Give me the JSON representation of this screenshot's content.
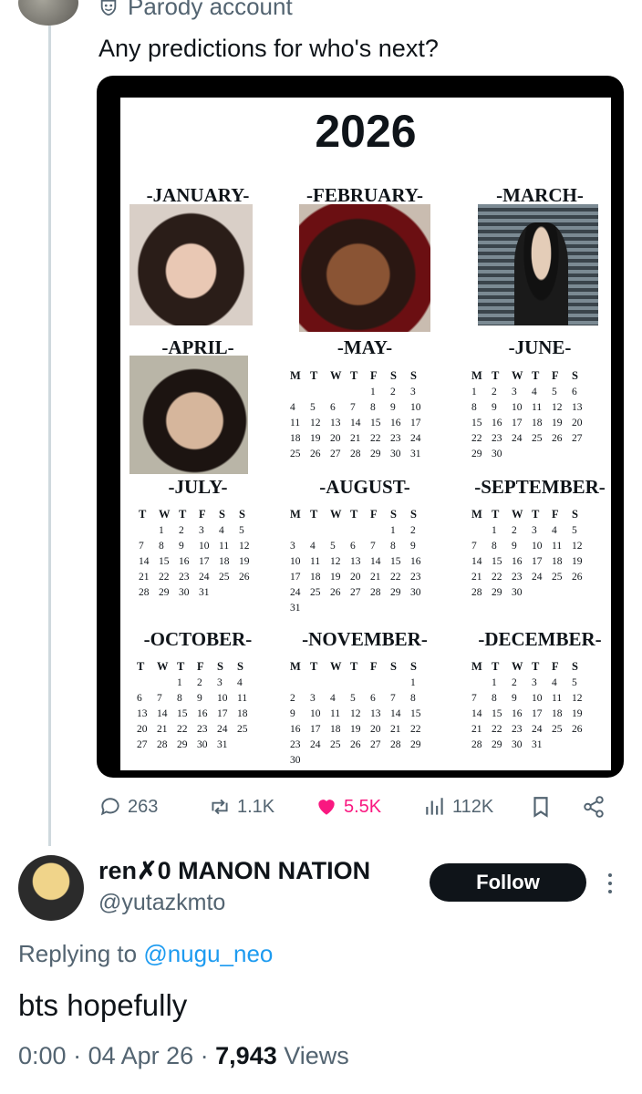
{
  "parent_tweet": {
    "label": "Parody account",
    "text": "Any predictions for who's next?"
  },
  "calendar": {
    "year": "2026",
    "months": [
      {
        "name": "-JANUARY-",
        "has_photo": true
      },
      {
        "name": "-FEBRUARY-",
        "has_photo": true
      },
      {
        "name": "-MARCH-",
        "has_photo": true
      },
      {
        "name": "-APRIL-",
        "has_photo": true
      },
      {
        "name": "-MAY-",
        "rows": [
          [
            "M",
            "T",
            "W",
            "T",
            "F",
            "S",
            "S"
          ],
          [
            "",
            "",
            "",
            "",
            "1",
            "2",
            "3"
          ],
          [
            "4",
            "5",
            "6",
            "7",
            "8",
            "9",
            "10"
          ],
          [
            "11",
            "12",
            "13",
            "14",
            "15",
            "16",
            "17"
          ],
          [
            "18",
            "19",
            "20",
            "21",
            "22",
            "23",
            "24"
          ],
          [
            "25",
            "26",
            "27",
            "28",
            "29",
            "30",
            "31"
          ]
        ]
      },
      {
        "name": "-JUNE-",
        "rows": [
          [
            "M",
            "T",
            "W",
            "T",
            "F",
            "S"
          ],
          [
            "1",
            "2",
            "3",
            "4",
            "5",
            "6"
          ],
          [
            "8",
            "9",
            "10",
            "11",
            "12",
            "13"
          ],
          [
            "15",
            "16",
            "17",
            "18",
            "19",
            "20"
          ],
          [
            "22",
            "23",
            "24",
            "25",
            "26",
            "27"
          ],
          [
            "29",
            "30",
            "",
            "",
            "",
            ""
          ]
        ]
      },
      {
        "name": "-JULY-",
        "rows": [
          [
            "T",
            "W",
            "T",
            "F",
            "S",
            "S"
          ],
          [
            "",
            "1",
            "2",
            "3",
            "4",
            "5"
          ],
          [
            "7",
            "8",
            "9",
            "10",
            "11",
            "12"
          ],
          [
            "14",
            "15",
            "16",
            "17",
            "18",
            "19"
          ],
          [
            "21",
            "22",
            "23",
            "24",
            "25",
            "26"
          ],
          [
            "28",
            "29",
            "30",
            "31",
            "",
            ""
          ]
        ]
      },
      {
        "name": "-AUGUST-",
        "rows": [
          [
            "M",
            "T",
            "W",
            "T",
            "F",
            "S",
            "S"
          ],
          [
            "",
            "",
            "",
            "",
            "",
            "1",
            "2"
          ],
          [
            "3",
            "4",
            "5",
            "6",
            "7",
            "8",
            "9"
          ],
          [
            "10",
            "11",
            "12",
            "13",
            "14",
            "15",
            "16"
          ],
          [
            "17",
            "18",
            "19",
            "20",
            "21",
            "22",
            "23"
          ],
          [
            "24",
            "25",
            "26",
            "27",
            "28",
            "29",
            "30"
          ],
          [
            "31",
            "",
            "",
            "",
            "",
            "",
            ""
          ]
        ]
      },
      {
        "name": "-SEPTEMBER-",
        "rows": [
          [
            "M",
            "T",
            "W",
            "T",
            "F",
            "S"
          ],
          [
            "",
            "1",
            "2",
            "3",
            "4",
            "5"
          ],
          [
            "7",
            "8",
            "9",
            "10",
            "11",
            "12"
          ],
          [
            "14",
            "15",
            "16",
            "17",
            "18",
            "19"
          ],
          [
            "21",
            "22",
            "23",
            "24",
            "25",
            "26"
          ],
          [
            "28",
            "29",
            "30",
            "",
            "",
            ""
          ]
        ]
      },
      {
        "name": "-OCTOBER-",
        "rows": [
          [
            "T",
            "W",
            "T",
            "F",
            "S",
            "S"
          ],
          [
            "",
            "",
            "1",
            "2",
            "3",
            "4"
          ],
          [
            "6",
            "7",
            "8",
            "9",
            "10",
            "11"
          ],
          [
            "13",
            "14",
            "15",
            "16",
            "17",
            "18"
          ],
          [
            "20",
            "21",
            "22",
            "23",
            "24",
            "25"
          ],
          [
            "27",
            "28",
            "29",
            "30",
            "31",
            ""
          ]
        ]
      },
      {
        "name": "-NOVEMBER-",
        "rows": [
          [
            "M",
            "T",
            "W",
            "T",
            "F",
            "S",
            "S"
          ],
          [
            "",
            "",
            "",
            "",
            "",
            "",
            "1"
          ],
          [
            "2",
            "3",
            "4",
            "5",
            "6",
            "7",
            "8"
          ],
          [
            "9",
            "10",
            "11",
            "12",
            "13",
            "14",
            "15"
          ],
          [
            "16",
            "17",
            "18",
            "19",
            "20",
            "21",
            "22"
          ],
          [
            "23",
            "24",
            "25",
            "26",
            "27",
            "28",
            "29"
          ],
          [
            "30",
            "",
            "",
            "",
            "",
            "",
            ""
          ]
        ]
      },
      {
        "name": "-DECEMBER-",
        "rows": [
          [
            "M",
            "T",
            "W",
            "T",
            "F",
            "S"
          ],
          [
            "",
            "1",
            "2",
            "3",
            "4",
            "5"
          ],
          [
            "7",
            "8",
            "9",
            "10",
            "11",
            "12"
          ],
          [
            "14",
            "15",
            "16",
            "17",
            "18",
            "19"
          ],
          [
            "21",
            "22",
            "23",
            "24",
            "25",
            "26"
          ],
          [
            "28",
            "29",
            "30",
            "31",
            "",
            ""
          ]
        ]
      }
    ]
  },
  "actions": {
    "replies": "263",
    "reposts": "1.1K",
    "likes": "5.5K",
    "views": "112K"
  },
  "reply": {
    "name": "ren✗0 MANON NATION",
    "handle": "@yutazkmto",
    "follow_label": "Follow",
    "replying_prefix": "Replying to",
    "replying_to": "@nugu_neo",
    "text": "bts hopefully",
    "time": "0:00",
    "date": "04 Apr 26",
    "views_count": "7,943",
    "views_label": "Views"
  },
  "colors": {
    "like": "#f91880",
    "link": "#1d9bf0",
    "muted": "#536471"
  }
}
